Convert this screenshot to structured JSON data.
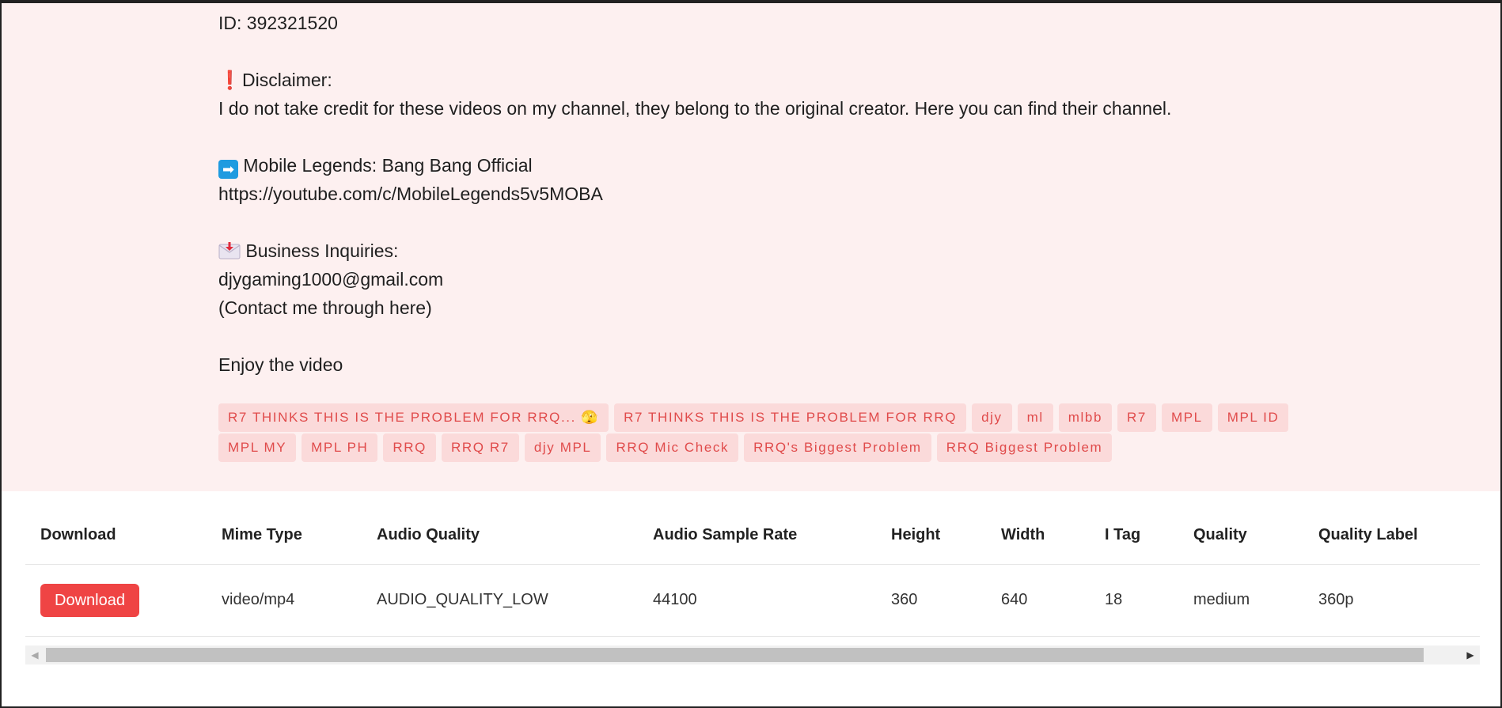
{
  "description": {
    "id_line": "ID: 392321520",
    "disclaimer_label": "Disclaimer:",
    "disclaimer_text": "I do not take credit for these videos on my channel, they belong to the original creator. Here you can find their channel.",
    "channel_name": "Mobile Legends: Bang Bang Official",
    "channel_url": "https://youtube.com/c/MobileLegends5v5MOBA",
    "business_label": "Business Inquiries:",
    "email": "djygaming1000@gmail.com",
    "contact_note": "(Contact me through here)",
    "closing": "Enjoy the video"
  },
  "tags": [
    "R7 THINKS THIS IS THE PROBLEM FOR RRQ... 🫣",
    "R7 THINKS THIS IS THE PROBLEM FOR RRQ",
    "djy",
    "ml",
    "mlbb",
    "R7",
    "MPL",
    "MPL ID",
    "MPL MY",
    "MPL PH",
    "RRQ",
    "RRQ R7",
    "djy MPL",
    "RRQ Mic Check",
    "RRQ's Biggest Problem",
    "RRQ Biggest Problem"
  ],
  "table": {
    "headers": [
      "Download",
      "Mime Type",
      "Audio Quality",
      "Audio Sample Rate",
      "Height",
      "Width",
      "I Tag",
      "Quality",
      "Quality Label"
    ],
    "rows": [
      {
        "download_label": "Download",
        "mime_type": "video/mp4",
        "audio_quality": "AUDIO_QUALITY_LOW",
        "audio_sample_rate": "44100",
        "height": "360",
        "width": "640",
        "itag": "18",
        "quality": "medium",
        "quality_label": "360p"
      }
    ]
  },
  "colors": {
    "section_bg": "#fdf0f0",
    "tag_bg": "#fbdada",
    "tag_text": "#e04b4b",
    "button_bg": "#ef4444"
  }
}
